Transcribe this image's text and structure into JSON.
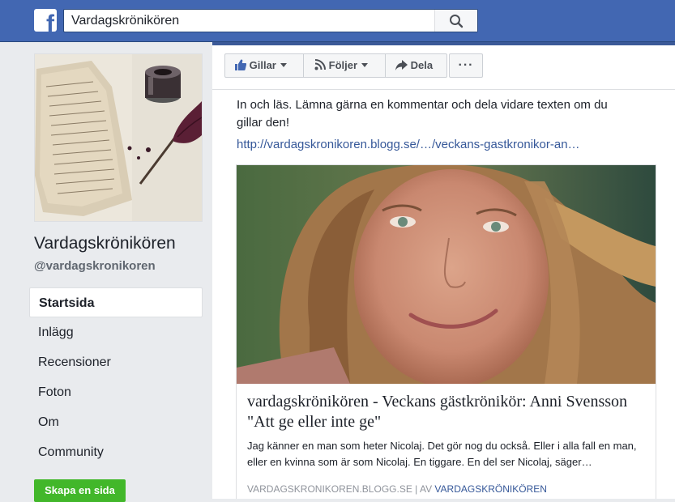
{
  "topbar": {
    "logo_letter": "f",
    "search_value": "Vardagskrönikören"
  },
  "page": {
    "name": "Vardagskrönikören",
    "handle": "@vardagskronikoren"
  },
  "nav": {
    "items": [
      {
        "label": "Startsida"
      },
      {
        "label": "Inlägg"
      },
      {
        "label": "Recensioner"
      },
      {
        "label": "Foton"
      },
      {
        "label": "Om"
      },
      {
        "label": "Community"
      }
    ],
    "create_page_label": "Skapa en sida"
  },
  "actions": {
    "like_label": "Gillar",
    "follow_label": "Följer",
    "share_label": "Dela",
    "more_label": "···"
  },
  "post": {
    "text": "In och läs. Lämna gärna en kommentar och dela vidare texten om du gillar den!",
    "link": "http://vardagskronikoren.blogg.se/…/veckans-gastkronikor-an…",
    "preview": {
      "title": "vardagskrönikören - Veckans gästkrönikör: Anni Svensson \"Att ge eller inte ge\"",
      "description": "Jag känner en man som heter Nicolaj. Det gör nog du också. Eller i alla fall en man, eller en kvinna som är som Nicolaj. En tiggare. En del ser Nicolaj, säger…",
      "source_domain": "VARDAGSKRONIKOREN.BLOGG.SE",
      "source_separator": " | AV ",
      "source_author": "VARDAGSKRÖNIKÖREN"
    }
  },
  "colors": {
    "topbar": "#4267b2",
    "link": "#365899",
    "create_button": "#42b72a",
    "background": "#e9ebee"
  },
  "icons": [
    "facebook-logo-icon",
    "search-icon",
    "thumbs-up-icon",
    "rss-follow-icon",
    "share-arrow-icon",
    "more-dots-icon"
  ]
}
